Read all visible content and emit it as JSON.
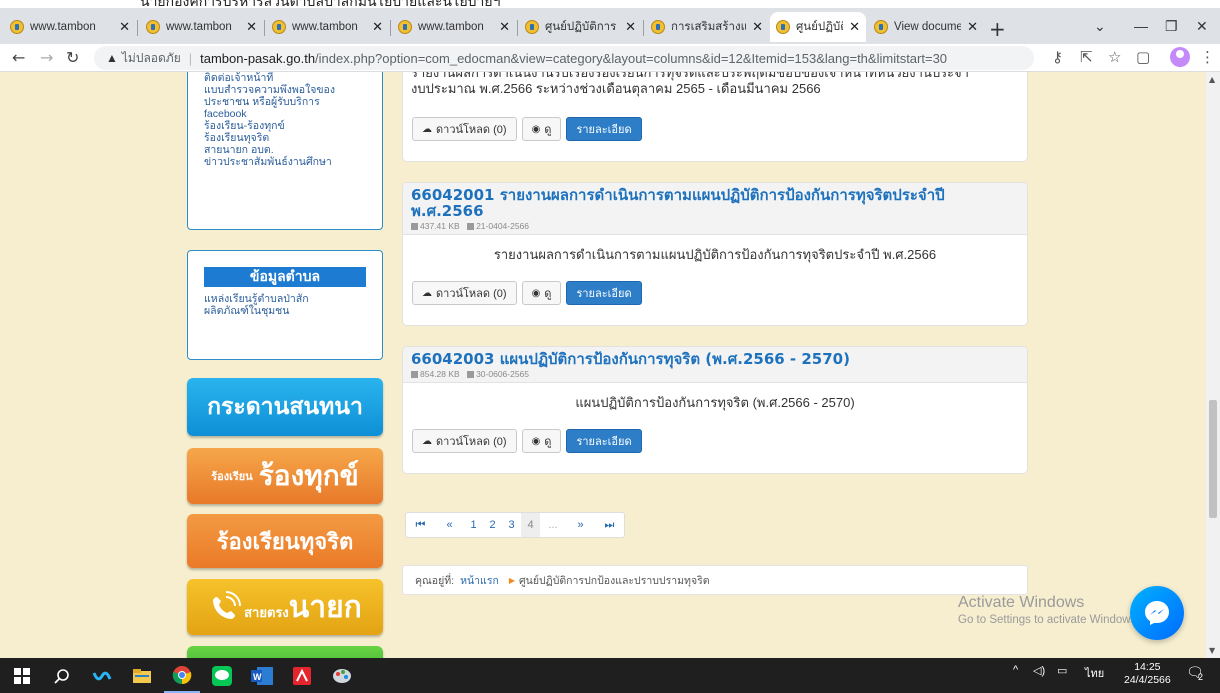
{
  "browser": {
    "tabs": [
      {
        "label": "www.tambon",
        "active": false
      },
      {
        "label": "www.tambon",
        "active": false
      },
      {
        "label": "www.tambon",
        "active": false
      },
      {
        "label": "www.tambon",
        "active": false
      },
      {
        "label": "ศูนย์ปฏิบัติการ",
        "active": false
      },
      {
        "label": "การเสริมสร้างและ",
        "active": false
      },
      {
        "label": "ศูนย์ปฏิบัติการ",
        "active": true
      },
      {
        "label": "View docume",
        "active": false
      }
    ],
    "address": {
      "not_secure": "ไม่ปลอดภัย",
      "host": "tambon-pasak.go.th",
      "path": "/index.php?option=com_edocman&view=category&layout=columns&id=12&Itemid=153&lang=th&limitstart=30"
    }
  },
  "top_cut_text": "นายกองค์การบริหารส่วนตำบลปาสักมีนโยบายและนโยบายฯ",
  "sidebar": {
    "box1_links": [
      "ติดต่อเจ้าหน้าที่",
      "แบบสำรวจความพึงพอใจของ",
      "ประชาชน หรือผู้รับบริการ",
      "facebook",
      "ร้องเรียน-ร้องทุกข์",
      "ร้องเรียนทุจริต",
      "สายนายก อบต.",
      "ข่าวประชาสัมพันธ์งานศึกษา"
    ],
    "box2_heading": "ข้อมูลตำบล",
    "box2_links": [
      "แหล่งเรียนรู้ตำบลป่าสัก",
      "ผลิตภัณฑ์ในชุมชน"
    ],
    "banners": {
      "board": "กระดานสนทนา",
      "complain_small": "ร้องเรียน",
      "complain_big": "ร้องทุกข์",
      "corruption": "ร้องเรียนทุจริต",
      "hotline_small": "สายตรง",
      "hotline_big": "นายก"
    }
  },
  "documents": [
    {
      "title": "",
      "size": "",
      "date": "",
      "description_line1": "รายงานผลการดำเนินงานรับเรื่องร้องเรียนการทุจริตและประพฤติมิชอบของเจ้าหน้าที่หน่วยงานประจำ",
      "description_line2": "งบประมาณ พ.ศ.2566 ระหว่างช่วงเดือนตุลาคม 2565 - เดือนมีนาคม 2566"
    },
    {
      "title": "66042001 รายงานผลการดำเนินการตามแผนปฏิบัติการป้องกันการทุจริตประจำปี พ.ศ.2566",
      "size": "437.41 KB",
      "date": "21-0404-2566",
      "description_line1": "รายงานผลการดำเนินการตามแผนปฏิบัติการป้องกันการทุจริตประจำปี พ.ศ.2566",
      "description_line2": ""
    },
    {
      "title": "66042003 แผนปฏิบัติการป้องกันการทุจริต (พ.ศ.2566 - 2570)",
      "size": "854.28 KB",
      "date": "30-0606-2565",
      "description_line1": "แผนปฏิบัติการป้องกันการทุจริต (พ.ศ.2566 - 2570)",
      "description_line2": ""
    }
  ],
  "buttons": {
    "download": "ดาวน์โหลด (0)",
    "view": "ดู",
    "details": "รายละเอียด"
  },
  "pagination": {
    "first": "⏮",
    "prev": "«",
    "pages": [
      "1",
      "2",
      "3",
      "4",
      "..."
    ],
    "next": "»",
    "last": "⏭"
  },
  "breadcrumb": {
    "prefix": "คุณอยู่ที่:",
    "home": "หน้าแรก",
    "current": "ศูนย์ปฏิบัติการปกป้องและปราบปรามทุจริต"
  },
  "watermark": {
    "line1": "Activate Windows",
    "line2": "Go to Settings to activate Windows."
  },
  "taskbar": {
    "lang": "ไทย",
    "time": "14:25",
    "date": "24/4/2566",
    "notif_count": "2"
  },
  "colors": {
    "page_bg": "#f6eecf",
    "link_blue": "#1e72bd",
    "primary_button": "#2d7ec7"
  }
}
